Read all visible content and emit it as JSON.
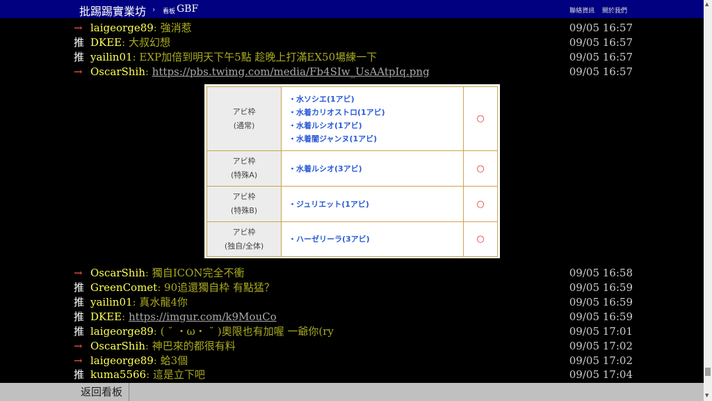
{
  "header": {
    "site_title": "批踢踢實業坊",
    "separator": "›",
    "board_prefix": "看板",
    "board_name": "GBF",
    "links": [
      "聯絡資訊",
      "關於我們"
    ]
  },
  "pushes_before": [
    {
      "tag": "→",
      "type": "arrow",
      "user": "laigeorge89",
      "content": ": 強消惹",
      "time": "09/05 16:57"
    },
    {
      "tag": "推",
      "type": "good",
      "user": "DKEE",
      "content": ": 大叔幻想",
      "time": "09/05 16:57"
    },
    {
      "tag": "推",
      "type": "good",
      "user": "yailin01",
      "content": ": EXP加倍到明天下午5點 趁晚上打滿EX50場練一下",
      "time": "09/05 16:57"
    },
    {
      "tag": "→",
      "type": "arrow",
      "user": "OscarShih",
      "content_prefix": ": ",
      "link": "https://pbs.twimg.com/media/Fb4SIw_UsAAtpIq.png",
      "time": "09/05 16:57"
    }
  ],
  "image_table": {
    "rows": [
      {
        "head": [
          "アビ枠",
          "(通常)"
        ],
        "items": [
          "・水ソシエ(1アビ)",
          "・水着カリオストロ(1アビ)",
          "・水着ルシオ(1アビ)",
          "・水着闇ジャンヌ(1アビ)"
        ],
        "mark": "○"
      },
      {
        "head": [
          "アビ枠",
          "(特殊A)"
        ],
        "items": [
          "・水着ルシオ(3アビ)"
        ],
        "mark": "○"
      },
      {
        "head": [
          "アビ枠",
          "(特殊B)"
        ],
        "items": [
          "・ジュリエット(1アビ)"
        ],
        "mark": "○"
      },
      {
        "head": [
          "アビ枠",
          "(独自/全体)"
        ],
        "items": [
          "・ハーゼリーラ(3アビ)"
        ],
        "mark": "○"
      }
    ]
  },
  "pushes_after": [
    {
      "tag": "→",
      "type": "arrow",
      "user": "OscarShih",
      "content": ": 獨自ICON完全不衝",
      "time": "09/05 16:58"
    },
    {
      "tag": "推",
      "type": "good",
      "user": "GreenComet",
      "content": ": 90追還獨自枠 有點猛？",
      "time": "09/05 16:59"
    },
    {
      "tag": "推",
      "type": "good",
      "user": "yailin01",
      "content": ": 真水龍4你",
      "time": "09/05 16:59"
    },
    {
      "tag": "推",
      "type": "good",
      "user": "DKEE",
      "content_prefix": ": ",
      "link": "https://imgur.com/k9MouCo",
      "time": "09/05 16:59"
    },
    {
      "tag": "推",
      "type": "good",
      "user": "laigeorge89",
      "content": ": ( ˘ ・ω・ ˘ )奧限也有加喔 一爺你(ry",
      "time": "09/05 17:01"
    },
    {
      "tag": "→",
      "type": "arrow",
      "user": "OscarShih",
      "content": ": 神巴來的都很有料",
      "time": "09/05 17:02"
    },
    {
      "tag": "→",
      "type": "arrow",
      "user": "laigeorge89",
      "content": ": 蛤3個",
      "time": "09/05 17:02"
    },
    {
      "tag": "推",
      "type": "good",
      "user": "kuma5566",
      "content": ": 這是立下吧",
      "time": "09/05 17:04"
    }
  ],
  "footer": {
    "back_label": "返回看板"
  }
}
